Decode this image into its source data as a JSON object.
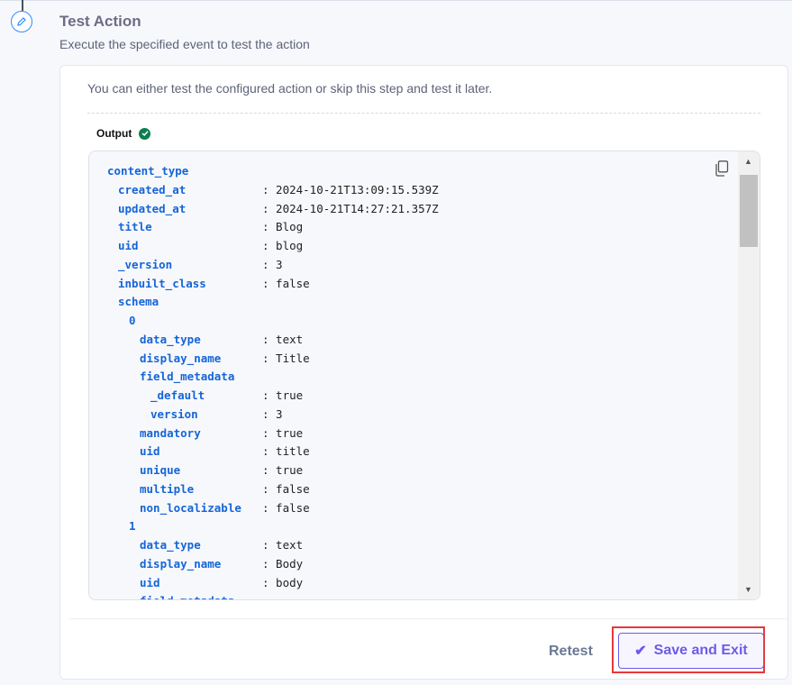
{
  "header": {
    "title": "Test Action",
    "subtitle": "Execute the specified event to test the action"
  },
  "card": {
    "info": "You can either test the configured action or skip this step and test it later.",
    "output_label": "Output",
    "output_status": "success"
  },
  "output_lines": [
    {
      "indent": 0,
      "key": "content_type",
      "value": ""
    },
    {
      "indent": 1,
      "key": "created_at",
      "value": ": 2024-10-21T13:09:15.539Z"
    },
    {
      "indent": 1,
      "key": "updated_at",
      "value": ": 2024-10-21T14:27:21.357Z"
    },
    {
      "indent": 1,
      "key": "title",
      "value": ": Blog"
    },
    {
      "indent": 1,
      "key": "uid",
      "value": ": blog"
    },
    {
      "indent": 1,
      "key": "_version",
      "value": ": 3"
    },
    {
      "indent": 1,
      "key": "inbuilt_class",
      "value": ": false"
    },
    {
      "indent": 1,
      "key": "schema",
      "value": ""
    },
    {
      "indent": 2,
      "key": "0",
      "value": ""
    },
    {
      "indent": 3,
      "key": "data_type",
      "value": ": text"
    },
    {
      "indent": 3,
      "key": "display_name",
      "value": ": Title"
    },
    {
      "indent": 3,
      "key": "field_metadata",
      "value": ""
    },
    {
      "indent": 4,
      "key": "_default",
      "value": ": true"
    },
    {
      "indent": 4,
      "key": "version",
      "value": ": 3"
    },
    {
      "indent": 3,
      "key": "mandatory",
      "value": ": true"
    },
    {
      "indent": 3,
      "key": "uid",
      "value": ": title"
    },
    {
      "indent": 3,
      "key": "unique",
      "value": ": true"
    },
    {
      "indent": 3,
      "key": "multiple",
      "value": ": false"
    },
    {
      "indent": 3,
      "key": "non_localizable",
      "value": ": false"
    },
    {
      "indent": 2,
      "key": "1",
      "value": ""
    },
    {
      "indent": 3,
      "key": "data_type",
      "value": ": text"
    },
    {
      "indent": 3,
      "key": "display_name",
      "value": ": Body"
    },
    {
      "indent": 3,
      "key": "uid",
      "value": ": body"
    },
    {
      "indent": 3,
      "key": "field_metadata",
      "value": ""
    }
  ],
  "footer": {
    "retest_label": "Retest",
    "save_label": "Save and Exit"
  },
  "colors": {
    "accent": "#6c5ce7",
    "key": "#1565d8",
    "success": "#0c7f4f",
    "highlight": "#e8373b"
  }
}
